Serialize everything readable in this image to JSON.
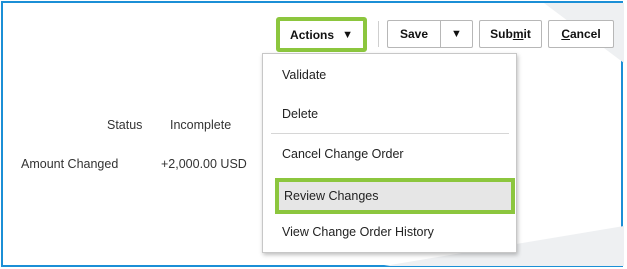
{
  "toolbar": {
    "actions_label": "Actions",
    "save_label": "Save",
    "submit_label_pre": "Sub",
    "submit_label_mnemonic": "m",
    "submit_label_post": "it",
    "cancel_label_mnemonic": "C",
    "cancel_label_post": "ancel",
    "caret_icon": "▼"
  },
  "actions_menu": {
    "items": [
      {
        "label": "Validate"
      },
      {
        "label": "Delete"
      },
      {
        "label": "Cancel Change Order"
      },
      {
        "label": "Review Changes",
        "highlighted": true
      },
      {
        "label": "View Change Order History"
      }
    ]
  },
  "details": {
    "status_label": "Status",
    "status_value": "Incomplete",
    "amount_label": "Amount Changed",
    "amount_value": "+2,000.00 USD"
  },
  "colors": {
    "frame_border": "#1b8fd6",
    "highlight_green": "#8cc63e",
    "menu_item_hover": "#e6e6e6"
  }
}
